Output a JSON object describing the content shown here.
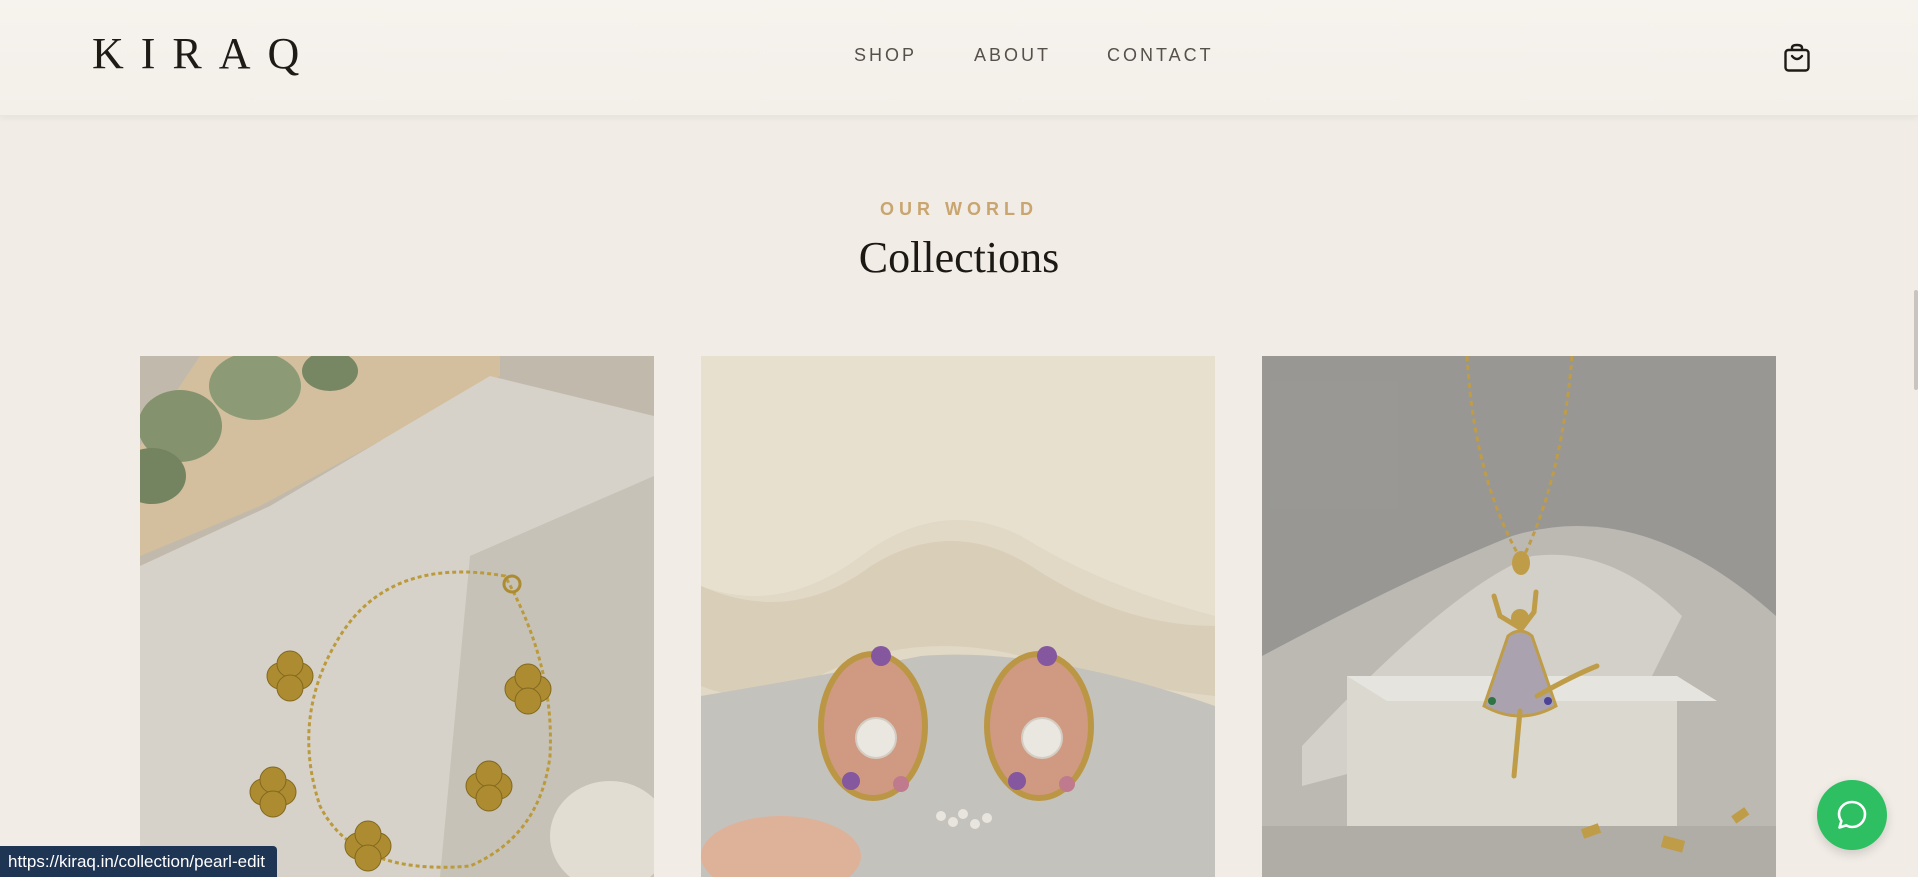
{
  "header": {
    "logo": "KIRAQ",
    "nav": [
      {
        "label": "SHOP"
      },
      {
        "label": "ABOUT"
      },
      {
        "label": "CONTACT"
      }
    ],
    "cart_icon": "shopping-bag-icon"
  },
  "section": {
    "eyebrow": "OUR WORLD",
    "title": "Collections"
  },
  "collections": [
    {
      "image": "gold-clover-bracelet"
    },
    {
      "image": "pearl-enamel-earrings"
    },
    {
      "image": "ballerina-pendant-necklace"
    }
  ],
  "status_bar": {
    "url": "https://kiraq.in/collection/pearl-edit"
  },
  "chat_fab": {
    "icon": "chat-bubble-icon",
    "color": "#2ebf62"
  },
  "colors": {
    "background": "#f1ece6",
    "accent": "#c9a56f",
    "text": "#1c1915"
  }
}
